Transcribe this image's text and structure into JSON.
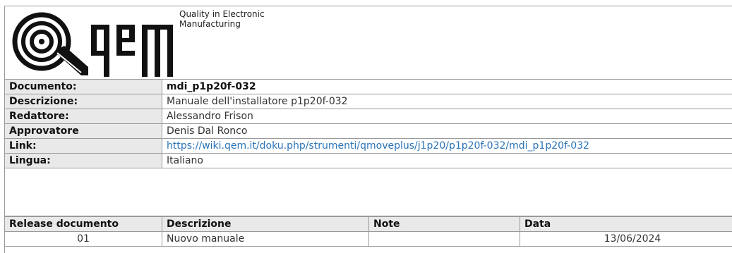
{
  "header": {
    "logo_text": "qem",
    "tagline_line1": "Quality in Electronic",
    "tagline_line2": "Manufacturing"
  },
  "info": [
    {
      "key": "Documento:",
      "value": "mdi_p1p20f-032"
    },
    {
      "key": "Descrizione:",
      "value": "Manuale dell'installatore p1p20f-032"
    },
    {
      "key": "Redattore:",
      "value": "Alessandro Frison"
    },
    {
      "key": "Approvatore",
      "value": "Denis Dal Ronco"
    },
    {
      "key": "Link:",
      "value": "https://wiki.qem.it/doku.php/strumenti/qmoveplus/j1p20/p1p20f-032/mdi_p1p20f-032"
    },
    {
      "key": "Lingua:",
      "value": "Italiano"
    }
  ],
  "release": {
    "headers": [
      "Release documento",
      "Descrizione",
      "Note",
      "Data"
    ],
    "rows": [
      [
        "01",
        "Nuovo manuale",
        "",
        "13/06/2024"
      ]
    ]
  },
  "colors": {
    "header_bg": "#e9e9e9",
    "border": "#9a9a9a",
    "link": "#2b73b7"
  }
}
